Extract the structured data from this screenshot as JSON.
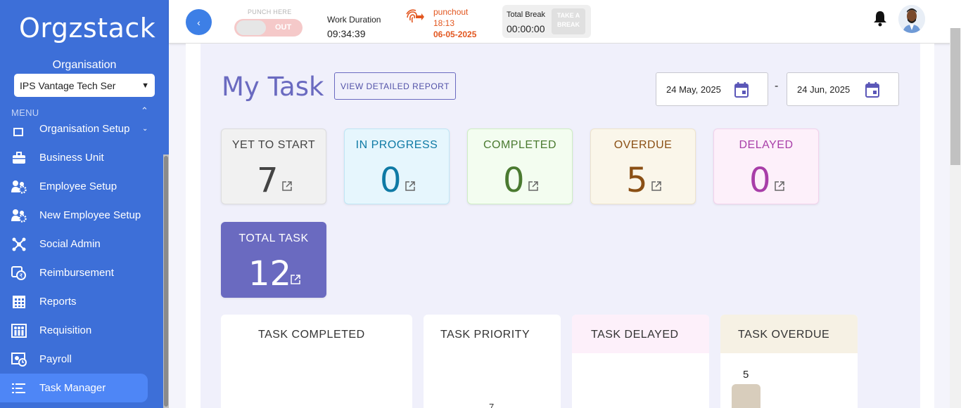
{
  "sidebar": {
    "logo": "Orgzstack",
    "org_label": "Organisation",
    "org_select": "IPS Vantage Tech Ser",
    "menu_label": "MENU",
    "items": [
      {
        "label": "Organisation Setup",
        "icon": "org-setup-icon"
      },
      {
        "label": "Business Unit",
        "icon": "briefcase-icon"
      },
      {
        "label": "Employee Setup",
        "icon": "employee-gear-icon"
      },
      {
        "label": "New Employee Setup",
        "icon": "new-employee-gear-icon"
      },
      {
        "label": "Social Admin",
        "icon": "social-admin-icon"
      },
      {
        "label": "Reimbursement",
        "icon": "reimbursement-icon"
      },
      {
        "label": "Reports",
        "icon": "reports-icon"
      },
      {
        "label": "Requisition",
        "icon": "requisition-icon"
      },
      {
        "label": "Payroll",
        "icon": "payroll-icon"
      },
      {
        "label": "Task Manager",
        "icon": "task-manager-icon",
        "active": true
      }
    ]
  },
  "header": {
    "punch_here": "PUNCH HERE",
    "toggle_label": "OUT",
    "work_duration_label": "Work Duration",
    "work_duration_value": "09:34:39",
    "punchout_label": "punchout",
    "punchout_time": "18:13",
    "punchout_date": "06-05-2025",
    "total_break_label": "Total Break",
    "total_break_value": "00:00:00",
    "take_break_label": "TAKE A BREAK"
  },
  "main": {
    "title": "My Task",
    "report_button": "VIEW DETAILED REPORT",
    "date_from": "24 May, 2025",
    "date_separator": "-",
    "date_to": "24 Jun, 2025",
    "cards": [
      {
        "label": "YET TO START",
        "value": "7",
        "bg": "#f1f1f1",
        "color": "#444444"
      },
      {
        "label": "IN PROGRESS",
        "value": "0",
        "bg": "#e6f6fd",
        "color": "#0f7aa5"
      },
      {
        "label": "COMPLETED",
        "value": "0",
        "bg": "#f3fdf0",
        "color": "#4a7a30"
      },
      {
        "label": "OVERDUE",
        "value": "5",
        "bg": "#faf6ea",
        "color": "#8a4f14"
      },
      {
        "label": "DELAYED",
        "value": "0",
        "bg": "#fdf0fa",
        "color": "#a83ea8"
      },
      {
        "label": "TOTAL TASK",
        "value": "12",
        "bg": "#6a6ac0",
        "color": "#ffffff"
      }
    ],
    "panels": [
      {
        "title": "TASK COMPLETED"
      },
      {
        "title": "TASK PRIORITY",
        "partial_value": "7"
      },
      {
        "title": "TASK DELAYED"
      },
      {
        "title": "TASK OVERDUE",
        "bar_value": "5"
      }
    ]
  }
}
